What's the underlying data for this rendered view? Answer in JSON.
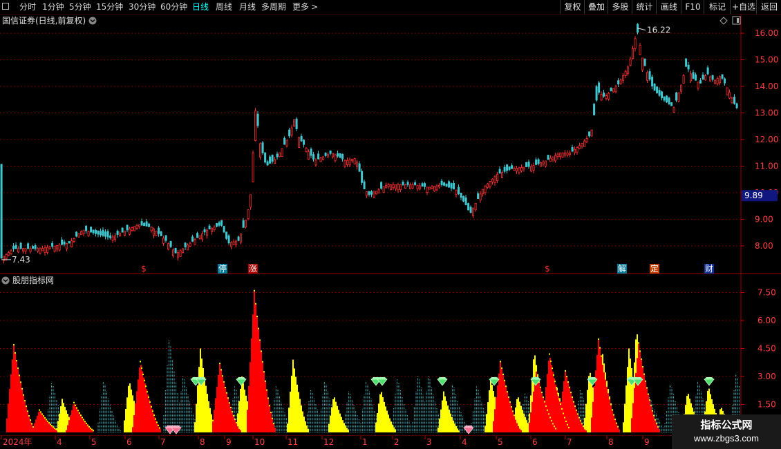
{
  "toolbar": {
    "checkbox_icon": "square-icon",
    "periods": [
      {
        "label": "分时",
        "active": false
      },
      {
        "label": "1分钟",
        "active": false
      },
      {
        "label": "5分钟",
        "active": false
      },
      {
        "label": "15分钟",
        "active": false
      },
      {
        "label": "30分钟",
        "active": false
      },
      {
        "label": "60分钟",
        "active": false
      },
      {
        "label": "日线",
        "active": true
      },
      {
        "label": "周线",
        "active": false
      },
      {
        "label": "月线",
        "active": false
      },
      {
        "label": "多周期",
        "active": false
      },
      {
        "label": "更多",
        "active": false
      }
    ],
    "more_icon": "chevron-right-icon",
    "right_buttons": [
      "复权",
      "叠加",
      "多股",
      "统计",
      "画线",
      "F10",
      "标记",
      "+自选",
      "返回"
    ]
  },
  "main_panel": {
    "title": "国信证券(日线,前复权)",
    "title_icon": "chevron-down-icon",
    "corner_icons": [
      "diamond-icon",
      "panel-toggle-icon"
    ],
    "price_axis": [
      "16.00",
      "15.00",
      "14.00",
      "13.00",
      "12.00",
      "11.00",
      "10.00",
      "9.00",
      "8.00"
    ],
    "current_price": "9.89",
    "high_label": "16.22",
    "low_label": "7.43",
    "markers": [
      {
        "text": "$",
        "color": "#ff3030",
        "bg": "#000000",
        "x": 208
      },
      {
        "text": "停",
        "color": "#ffffff",
        "bg": "#007a9a",
        "x": 322
      },
      {
        "text": "涨",
        "color": "#ffffff",
        "bg": "#b00000",
        "x": 366
      },
      {
        "text": "$",
        "color": "#ff3030",
        "bg": "#000000",
        "x": 792
      },
      {
        "text": "解",
        "color": "#ffffff",
        "bg": "#007a9a",
        "x": 900
      },
      {
        "text": "定",
        "color": "#ffffff",
        "bg": "#c04000",
        "x": 947
      },
      {
        "text": "财",
        "color": "#ffffff",
        "bg": "#1030a0",
        "x": 1026
      }
    ]
  },
  "sub_panel": {
    "title": "股朋指标网",
    "title_icon": "chevron-down-icon",
    "axis": [
      "7.50",
      "6.00",
      "4.50",
      "3.00",
      "1.50"
    ]
  },
  "date_axis": {
    "labels": [
      "2024年",
      "4",
      "5",
      "6",
      "7",
      "8",
      "9",
      "10",
      "11",
      "12",
      "1",
      "2",
      "3",
      "4",
      "5",
      "6",
      "7",
      "8",
      "9"
    ]
  },
  "watermark": {
    "title": "指标公式网",
    "url": "www.zbgs3.com"
  },
  "chart_data": {
    "type": "line",
    "price_series": {
      "keypoints": [
        [
          0,
          7.5
        ],
        [
          20,
          7.9
        ],
        [
          60,
          7.9
        ],
        [
          100,
          8.1
        ],
        [
          120,
          8.6
        ],
        [
          160,
          8.3
        ],
        [
          200,
          8.8
        ],
        [
          220,
          8.7
        ],
        [
          240,
          8.2
        ],
        [
          255,
          7.7
        ],
        [
          275,
          8.1
        ],
        [
          300,
          8.6
        ],
        [
          320,
          8.8
        ],
        [
          330,
          8.1
        ],
        [
          345,
          8.2
        ],
        [
          355,
          8.9
        ],
        [
          362,
          9.7
        ],
        [
          366,
          11.5
        ],
        [
          370,
          13.3
        ],
        [
          375,
          12.0
        ],
        [
          385,
          11.0
        ],
        [
          400,
          11.3
        ],
        [
          420,
          12.2
        ],
        [
          425,
          12.8
        ],
        [
          432,
          12.1
        ],
        [
          445,
          11.6
        ],
        [
          455,
          11.2
        ],
        [
          480,
          11.5
        ],
        [
          500,
          11.2
        ],
        [
          515,
          11.3
        ],
        [
          520,
          10.8
        ],
        [
          525,
          10.2
        ],
        [
          535,
          9.9
        ],
        [
          560,
          10.3
        ],
        [
          580,
          10.3
        ],
        [
          600,
          10.3
        ],
        [
          620,
          10.2
        ],
        [
          640,
          10.3
        ],
        [
          660,
          10.1
        ],
        [
          675,
          9.5
        ],
        [
          680,
          9.2
        ],
        [
          690,
          9.7
        ],
        [
          700,
          10.2
        ],
        [
          720,
          10.7
        ],
        [
          740,
          10.9
        ],
        [
          770,
          11.0
        ],
        [
          790,
          11.2
        ],
        [
          810,
          11.5
        ],
        [
          825,
          11.5
        ],
        [
          840,
          11.8
        ],
        [
          855,
          12.2
        ],
        [
          865,
          13.8
        ],
        [
          875,
          13.6
        ],
        [
          895,
          14.1
        ],
        [
          910,
          14.8
        ],
        [
          918,
          15.7
        ],
        [
          922,
          16.1
        ],
        [
          930,
          15.0
        ],
        [
          945,
          13.9
        ],
        [
          960,
          13.5
        ],
        [
          975,
          13.2
        ],
        [
          985,
          14.0
        ],
        [
          993,
          14.8
        ],
        [
          1003,
          14.3
        ],
        [
          1013,
          14.1
        ],
        [
          1023,
          14.5
        ],
        [
          1033,
          14.2
        ],
        [
          1043,
          14.4
        ],
        [
          1055,
          13.8
        ],
        [
          1065,
          13.2
        ]
      ],
      "high_label_value": 16.22,
      "low_label_value": 7.43,
      "y_range": [
        7.4,
        16.6
      ]
    },
    "indicator": {
      "y_range": [
        0,
        8.0
      ],
      "red_peaks": [
        [
          20,
          4.7
        ],
        [
          57,
          1.2
        ],
        [
          107,
          1.6
        ],
        [
          203,
          3.8
        ],
        [
          318,
          3.7
        ],
        [
          368,
          7.6
        ],
        [
          724,
          3.8
        ],
        [
          776,
          3.3
        ],
        [
          795,
          4.2
        ],
        [
          818,
          3.3
        ],
        [
          866,
          5.0
        ],
        [
          924,
          4.8
        ]
      ],
      "yellow_peaks": [
        [
          90,
          1.8
        ],
        [
          187,
          2.8
        ],
        [
          290,
          4.5
        ],
        [
          350,
          3.0
        ],
        [
          424,
          3.9
        ],
        [
          483,
          2.0
        ],
        [
          551,
          2.3
        ],
        [
          642,
          2.2
        ],
        [
          710,
          2.9
        ],
        [
          749,
          2.0
        ],
        [
          773,
          4.4
        ],
        [
          806,
          2.4
        ],
        [
          853,
          3.4
        ],
        [
          872,
          4.2
        ],
        [
          910,
          4.5
        ],
        [
          921,
          5.6
        ],
        [
          995,
          2.2
        ],
        [
          1025,
          2.5
        ],
        [
          1043,
          1.4
        ]
      ],
      "cyan_peaks": [
        [
          75,
          2.8
        ],
        [
          150,
          2.9
        ],
        [
          245,
          5.2
        ],
        [
          265,
          3.2
        ],
        [
          340,
          2.6
        ],
        [
          400,
          2.6
        ],
        [
          450,
          2.4
        ],
        [
          470,
          2.9
        ],
        [
          505,
          2.3
        ],
        [
          530,
          2.9
        ],
        [
          575,
          3.0
        ],
        [
          605,
          3.2
        ],
        [
          620,
          3.2
        ],
        [
          655,
          2.7
        ],
        [
          690,
          2.6
        ],
        [
          730,
          2.0
        ],
        [
          760,
          2.2
        ],
        [
          840,
          2.4
        ],
        [
          940,
          2.0
        ],
        [
          970,
          2.7
        ],
        [
          1010,
          2.9
        ],
        [
          1065,
          3.3
        ]
      ],
      "green_diamonds": [
        283,
        291,
        349,
        544,
        553,
        640,
        715,
        775,
        857,
        914,
        923,
        1026
      ],
      "pink_diamonds": [
        246,
        255,
        678
      ]
    }
  }
}
